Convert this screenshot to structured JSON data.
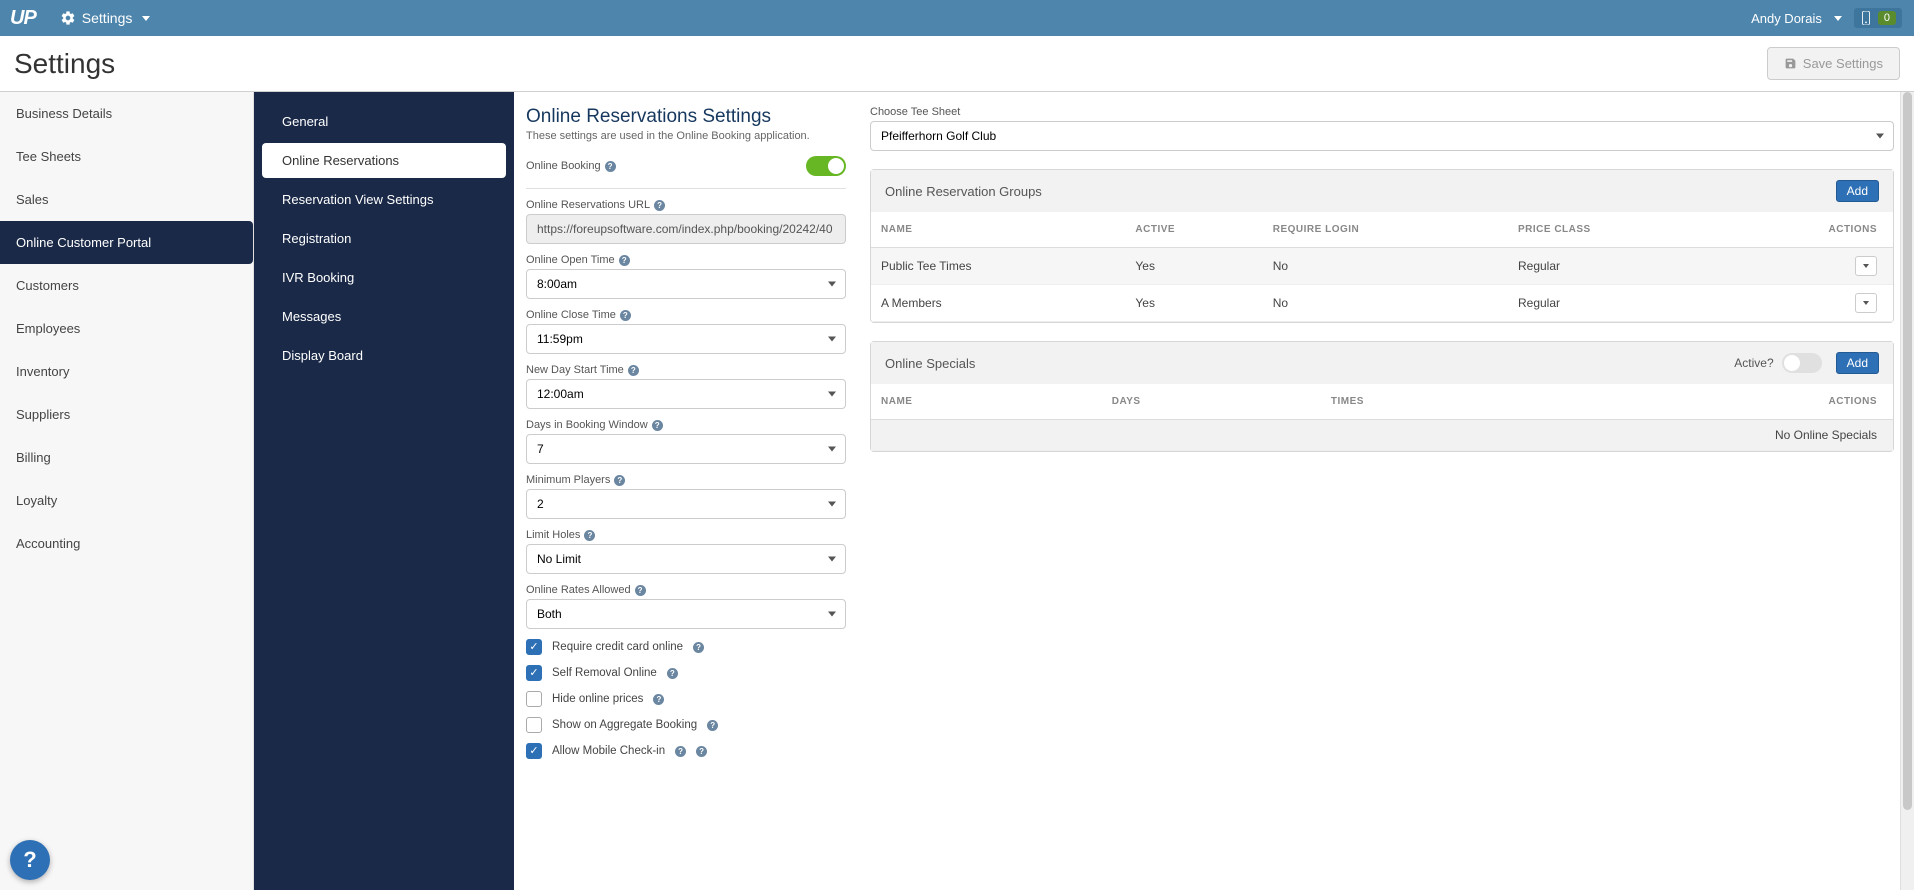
{
  "topbar": {
    "logo": "UP",
    "menu_label": "Settings",
    "user_name": "Andy Dorais",
    "device_count": "0"
  },
  "page": {
    "title": "Settings",
    "save_button": "Save Settings"
  },
  "sidebar_primary": {
    "items": [
      {
        "label": "Business Details"
      },
      {
        "label": "Tee Sheets"
      },
      {
        "label": "Sales"
      },
      {
        "label": "Online Customer Portal",
        "active": true
      },
      {
        "label": "Customers"
      },
      {
        "label": "Employees"
      },
      {
        "label": "Inventory"
      },
      {
        "label": "Suppliers"
      },
      {
        "label": "Billing"
      },
      {
        "label": "Loyalty"
      },
      {
        "label": "Accounting"
      }
    ]
  },
  "sidebar_secondary": {
    "items": [
      {
        "label": "General"
      },
      {
        "label": "Online Reservations",
        "active": true
      },
      {
        "label": "Reservation View Settings"
      },
      {
        "label": "Registration"
      },
      {
        "label": "IVR Booking"
      },
      {
        "label": "Messages"
      },
      {
        "label": "Display Board"
      }
    ]
  },
  "content": {
    "heading": "Online Reservations Settings",
    "subheading": "These settings are used in the Online Booking application.",
    "online_booking_label": "Online Booking",
    "online_booking_on": true,
    "fields": {
      "url_label": "Online Reservations URL",
      "url_value": "https://foreupsoftware.com/index.php/booking/20242/40",
      "open_label": "Online Open Time",
      "open_value": "8:00am",
      "close_label": "Online Close Time",
      "close_value": "11:59pm",
      "newday_label": "New Day Start Time",
      "newday_value": "12:00am",
      "days_label": "Days in Booking Window",
      "days_value": "7",
      "minplayers_label": "Minimum Players",
      "minplayers_value": "2",
      "limitholes_label": "Limit Holes",
      "limitholes_value": "No Limit",
      "rates_label": "Online Rates Allowed",
      "rates_value": "Both"
    },
    "checkboxes": [
      {
        "label": "Require credit card online",
        "checked": true
      },
      {
        "label": "Self Removal Online",
        "checked": true
      },
      {
        "label": "Hide online prices",
        "checked": false
      },
      {
        "label": "Show on Aggregate Booking",
        "checked": false
      },
      {
        "label": "Allow Mobile Check-in",
        "checked": true
      }
    ]
  },
  "right": {
    "tee_sheet_label": "Choose Tee Sheet",
    "tee_sheet_value": "Pfeifferhorn Golf Club",
    "groups_panel": {
      "title": "Online Reservation Groups",
      "add_label": "Add",
      "columns": [
        "NAME",
        "ACTIVE",
        "REQUIRE LOGIN",
        "PRICE CLASS",
        "ACTIONS"
      ],
      "rows": [
        {
          "name": "Public Tee Times",
          "active": "Yes",
          "require_login": "No",
          "price_class": "Regular"
        },
        {
          "name": "A Members",
          "active": "Yes",
          "require_login": "No",
          "price_class": "Regular"
        }
      ]
    },
    "specials_panel": {
      "title": "Online Specials",
      "active_label": "Active?",
      "active_on": false,
      "add_label": "Add",
      "columns": [
        "NAME",
        "DAYS",
        "TIMES",
        "ACTIONS"
      ],
      "empty": "No Online Specials"
    }
  }
}
